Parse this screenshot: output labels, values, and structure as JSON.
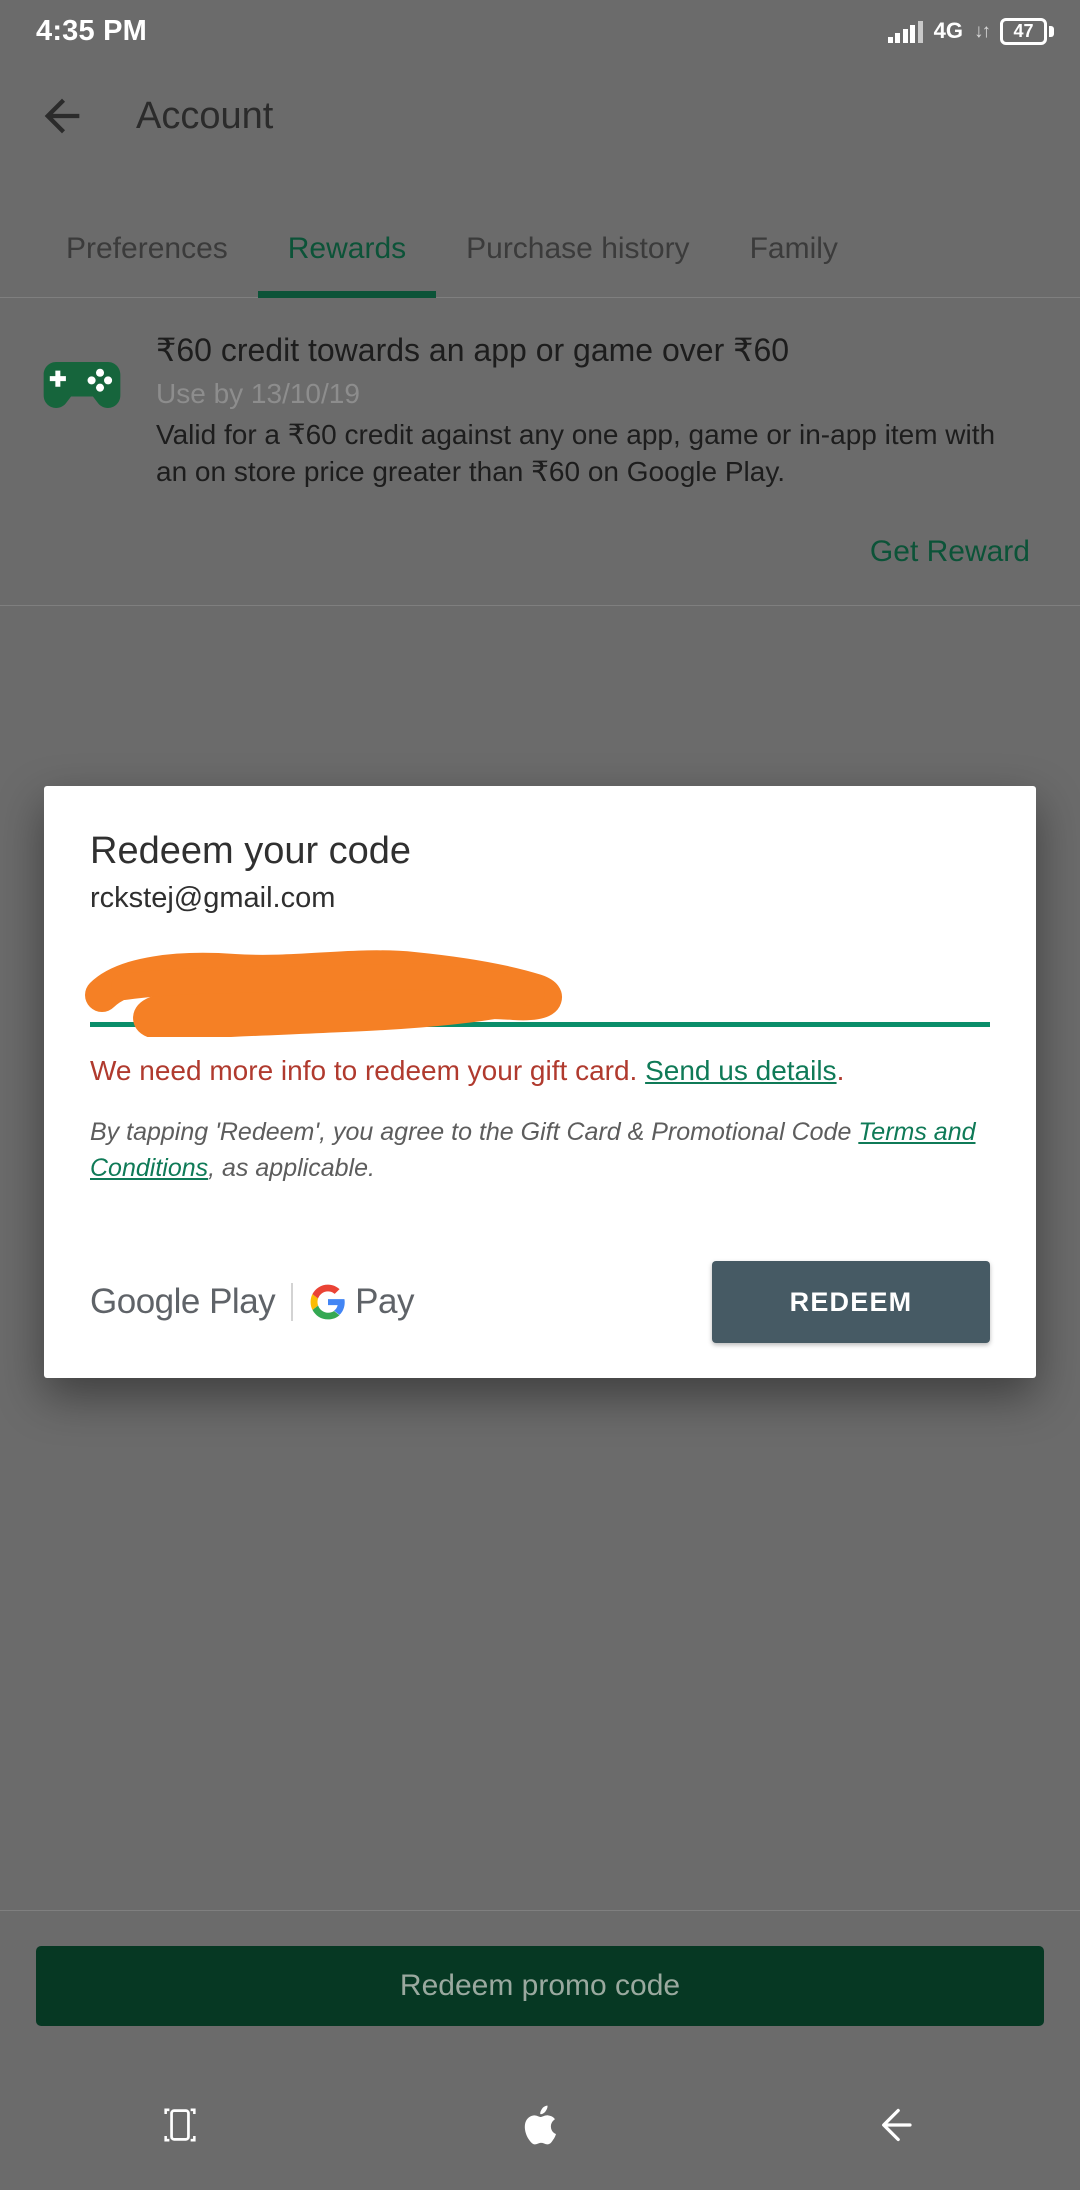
{
  "status_bar": {
    "time": "4:35 PM",
    "network_label": "4G",
    "data_arrows": "↓↑",
    "battery_level": "47",
    "signal_icon": "signal-bars-icon",
    "battery_icon": "battery-icon"
  },
  "app_bar": {
    "back_icon": "back-arrow-icon",
    "title": "Account"
  },
  "tabs": [
    {
      "label": "Preferences",
      "active": false
    },
    {
      "label": "Rewards",
      "active": true
    },
    {
      "label": "Purchase history",
      "active": false
    },
    {
      "label": "Family",
      "active": false
    }
  ],
  "reward_card": {
    "icon": "gamepad-icon",
    "title": "₹60 credit towards an app or game over ₹60",
    "expiry": "Use by 13/10/19",
    "description": "Valid for a ₹60 credit against any one app, game or in-app item with an on store price greater than ₹60 on Google Play.",
    "action_label": "Get Reward"
  },
  "dialog": {
    "title": "Redeem your code",
    "email": "rckstej@gmail.com",
    "code_input": {
      "value": "",
      "placeholder": "",
      "redacted": true,
      "redaction_color": "#f58025"
    },
    "error": {
      "message": "We need more info to redeem your gift card.",
      "link_label": "Send us details",
      "trailing": "."
    },
    "disclaimer": {
      "prefix": "By tapping 'Redeem', you agree to the Gift Card & Promotional Code ",
      "link_label": "Terms and Conditions",
      "suffix": ", as applicable."
    },
    "footer": {
      "google_play_label": "Google Play",
      "google_g_icon": "google-g-icon",
      "pay_label": "Pay",
      "redeem_button": "REDEEM"
    }
  },
  "bottom_bar": {
    "promo_button": "Redeem promo code"
  },
  "nav_bar": {
    "recents_icon": "recents-icon",
    "home_icon": "apple-home-icon",
    "back_icon": "nav-back-icon"
  },
  "colors": {
    "accent_green": "#0c5338",
    "link_green": "#0f7a57",
    "error_red": "#b03a2e",
    "redeem_button": "#465a64",
    "promo_button": "#063823",
    "scrim": "#6b6b6b"
  }
}
